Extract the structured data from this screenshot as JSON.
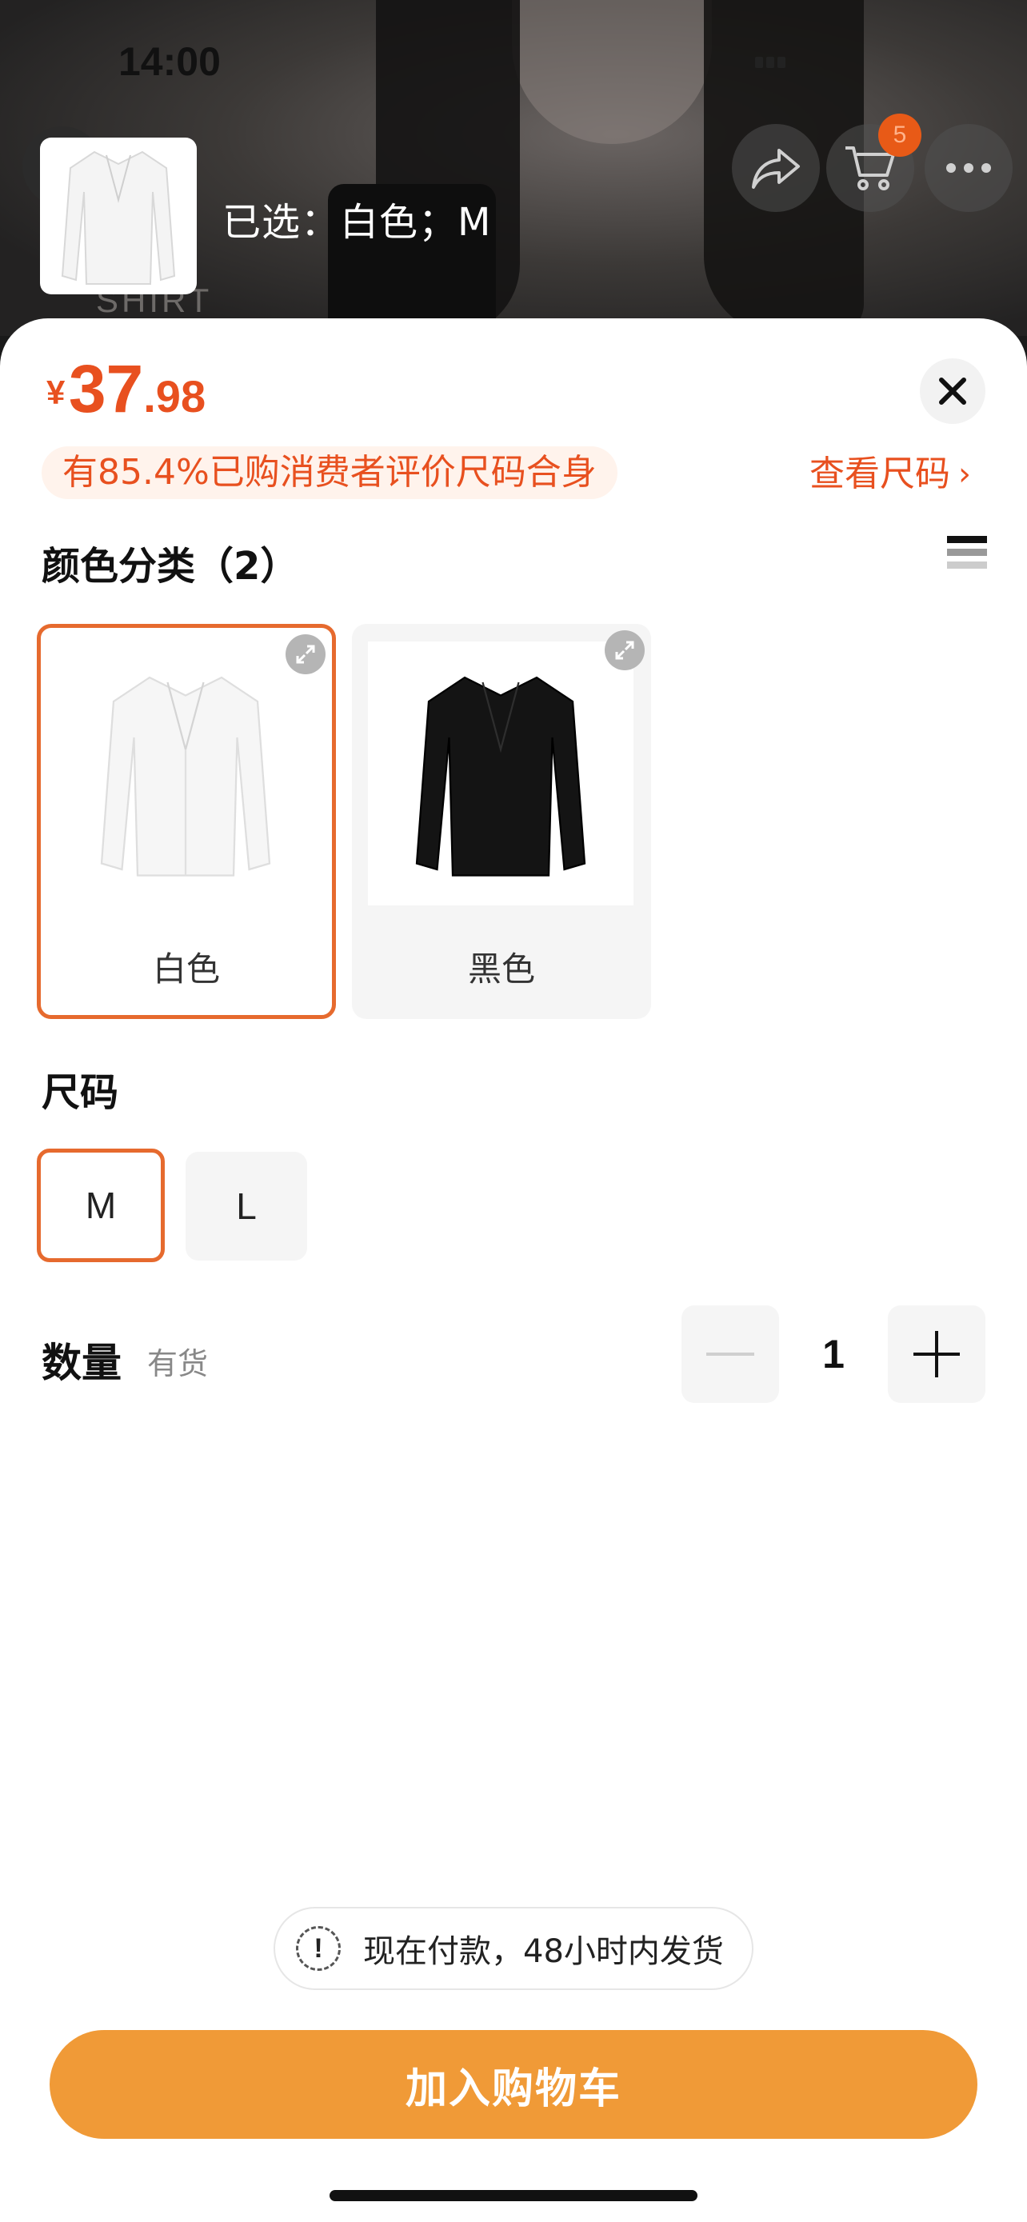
{
  "status_bar": {
    "time": "14:00"
  },
  "header": {
    "selected_text": "已选：白色；M",
    "cart_count": "5",
    "backdrop_text": "SHIRT"
  },
  "price": {
    "symbol": "¥",
    "integer": "37",
    "decimal": ".98"
  },
  "fit_banner": "有85.4%已购消费者评价尺码合身",
  "size_chart_link": "查看尺码",
  "color_section": {
    "title": "颜色分类（2）",
    "options": [
      {
        "label": "白色",
        "selected": true,
        "swatch": "#f2f2f2"
      },
      {
        "label": "黑色",
        "selected": false,
        "swatch": "#111111"
      }
    ]
  },
  "size_section": {
    "title": "尺码",
    "options": [
      {
        "label": "M",
        "selected": true
      },
      {
        "label": "L",
        "selected": false
      }
    ]
  },
  "quantity": {
    "label": "数量",
    "stock": "有货",
    "value": "1"
  },
  "notice": {
    "icon": "!",
    "text": "现在付款，48小时内发货"
  },
  "add_to_cart": "加入购物车",
  "colors": {
    "accent": "#e8501f",
    "selected_border": "#e66a2e",
    "button": "#f09a37"
  }
}
